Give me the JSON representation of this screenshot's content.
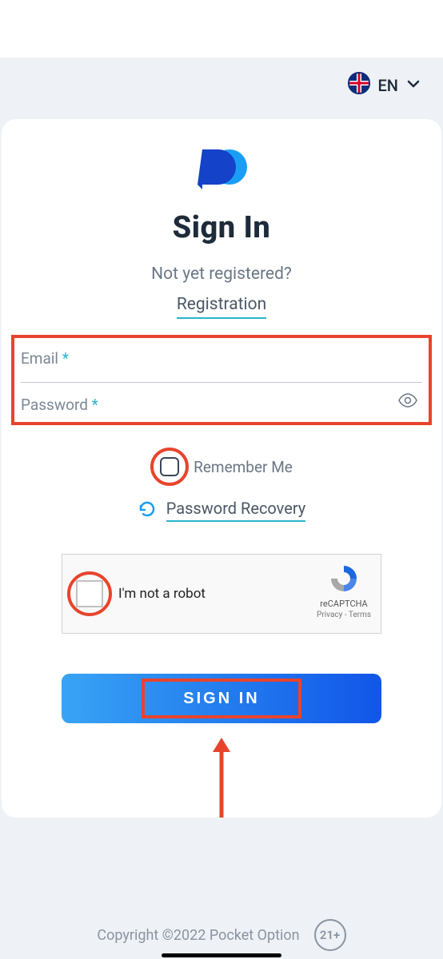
{
  "header": {
    "language_label": "EN"
  },
  "page": {
    "title": "Sign In",
    "subtitle": "Not yet registered?",
    "registration_link": "Registration"
  },
  "form": {
    "email_label": "Email",
    "password_label": "Password",
    "required_mark": "*",
    "remember_label": "Remember Me",
    "recovery_link": "Password Recovery",
    "signin_button": "SIGN IN"
  },
  "captcha": {
    "label": "I'm not a robot",
    "brand": "reCAPTCHA",
    "links": "Privacy - Terms"
  },
  "footer": {
    "copyright": "Copyright ©2022 Pocket Option",
    "age_badge": "21+"
  }
}
